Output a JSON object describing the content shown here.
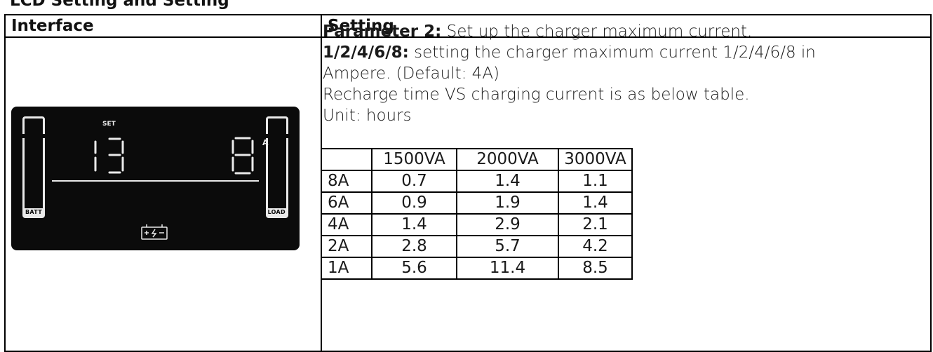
{
  "clipped_title": "LCD Setting and Setting",
  "header": {
    "interface": "Interface",
    "setting": "Setting"
  },
  "lcd": {
    "set_label": "SET",
    "unit_label": "A",
    "left_digits": "13",
    "right_digit": "8",
    "batt_label": "BATT",
    "load_label": "LOAD",
    "icon": "battery-charge-icon"
  },
  "setting": {
    "p1_bold": "Parameter 2:",
    "p1_text": " Set up the charger maximum current.",
    "p2_bold": "1/2/4/6/8:",
    "p2_text": " setting the charger maximum current 1/2/4/6/8 in",
    "p3_text": "Ampere. (Default: 4A)",
    "p4_text": "Recharge time VS charging current is as below table.",
    "p5_text": "Unit: hours"
  },
  "table": {
    "columns": [
      "",
      "1500VA",
      "2000VA",
      "3000VA"
    ],
    "rows": [
      {
        "label": "8A",
        "values": [
          "0.7",
          "1.4",
          "1.1"
        ]
      },
      {
        "label": "6A",
        "values": [
          "0.9",
          "1.9",
          "1.4"
        ]
      },
      {
        "label": "4A",
        "values": [
          "1.4",
          "2.9",
          "2.1"
        ]
      },
      {
        "label": "2A",
        "values": [
          "2.8",
          "5.7",
          "4.2"
        ]
      },
      {
        "label": "1A",
        "values": [
          "5.6",
          "11.4",
          "8.5"
        ]
      }
    ]
  }
}
